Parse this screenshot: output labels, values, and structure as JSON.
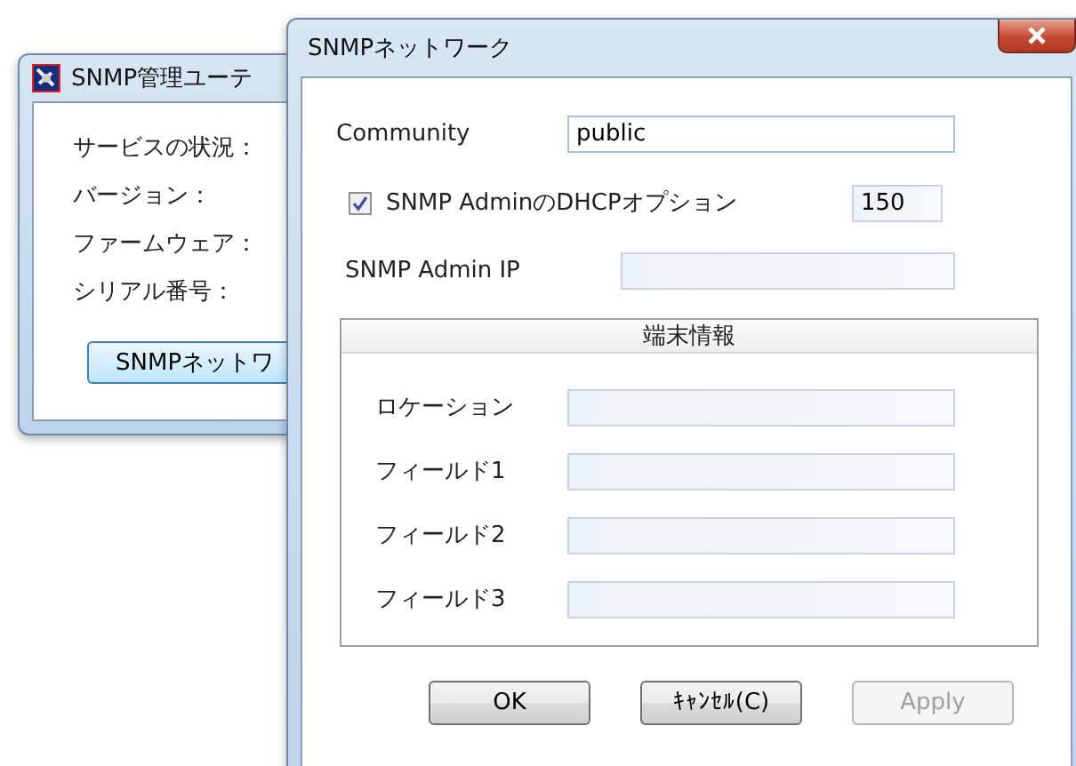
{
  "back_window": {
    "title": "SNMP管理ユーテ",
    "labels": [
      "サービスの状況：",
      "バージョン：",
      "ファームウェア：",
      "シリアル番号："
    ],
    "button": "SNMPネットワ"
  },
  "dialog": {
    "title": "SNMPネットワーク",
    "community": {
      "label": "Community",
      "value": "public"
    },
    "dhcp_option": {
      "label": "SNMP AdminのDHCPオプション",
      "checked": true,
      "value": "150"
    },
    "admin_ip": {
      "label": "SNMP Admin IP"
    },
    "group": {
      "title": "端末情報",
      "fields": [
        {
          "label": "ロケーション"
        },
        {
          "label": "フィールド1"
        },
        {
          "label": "フィールド2"
        },
        {
          "label": "フィールド3"
        }
      ]
    },
    "buttons": [
      {
        "label": "OK",
        "disabled": false
      },
      {
        "label": "ｷｬﾝｾﾙ(C)",
        "disabled": false
      },
      {
        "label": "Apply",
        "disabled": true
      }
    ]
  }
}
